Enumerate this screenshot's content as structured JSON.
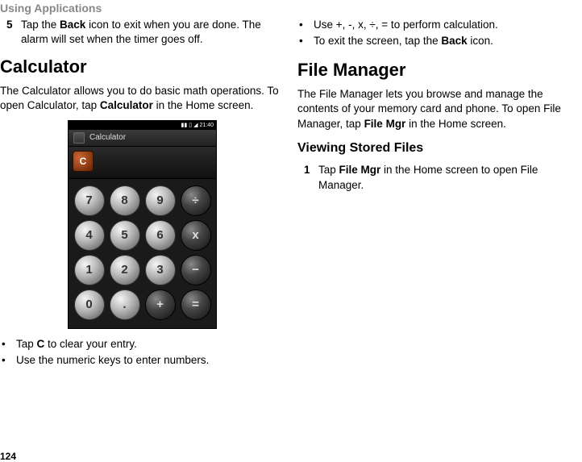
{
  "header": "Using Applications",
  "pageNum": "124",
  "left": {
    "step5": {
      "num": "5",
      "line1_a": "Tap the ",
      "line1_b": "Back",
      "line1_c": " icon to exit when you are done. The alarm will set when the timer goes off."
    },
    "calcTitle": "Calculator",
    "calcPara_a": "The Calculator allows you to do basic math operations. To open Calculator, tap ",
    "calcPara_b": "Calculator",
    "calcPara_c": " in the Home screen.",
    "bullets": {
      "b1_a": "Tap ",
      "b1_b": "C",
      "b1_c": " to clear your entry.",
      "b2": "Use the numeric keys to enter numbers."
    }
  },
  "right": {
    "bullets": {
      "b1": "Use +, -, x, ÷, = to perform calculation.",
      "b2_a": "To exit the screen, tap the ",
      "b2_b": "Back",
      "b2_c": " icon."
    },
    "fmTitle": "File Manager",
    "fmPara_a": "The File Manager lets you browse and manage the contents of your memory card and phone. To open File Manager, tap ",
    "fmPara_b": "File Mgr",
    "fmPara_c": " in the Home screen.",
    "vsfTitle": "Viewing Stored Files",
    "step1": {
      "num": "1",
      "a": "Tap ",
      "b": "File Mgr",
      "c": " in the Home screen to open File Manager."
    }
  },
  "phone": {
    "time": "21:40",
    "title": "Calculator",
    "clear": "C",
    "keys": [
      [
        "7",
        "num"
      ],
      [
        "8",
        "num"
      ],
      [
        "9",
        "num"
      ],
      [
        "÷",
        "op"
      ],
      [
        "4",
        "num"
      ],
      [
        "5",
        "num"
      ],
      [
        "6",
        "num"
      ],
      [
        "x",
        "op"
      ],
      [
        "1",
        "num"
      ],
      [
        "2",
        "num"
      ],
      [
        "3",
        "num"
      ],
      [
        "−",
        "op"
      ],
      [
        "0",
        "num"
      ],
      [
        ".",
        "num"
      ],
      [
        "+",
        "op"
      ],
      [
        "=",
        "op"
      ]
    ]
  }
}
